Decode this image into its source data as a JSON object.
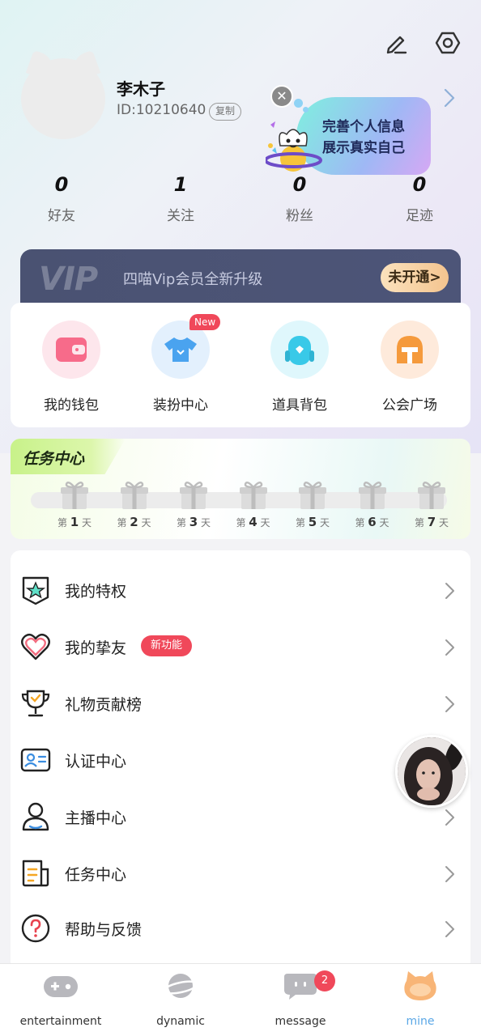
{
  "profile": {
    "username": "李木子",
    "id_text": "ID:10210640",
    "copy_label": "复制"
  },
  "promo_bubble": {
    "line1": "完善个人信息",
    "line2": "展示真实自己"
  },
  "stats": [
    {
      "value": "0",
      "label": "好友"
    },
    {
      "value": "1",
      "label": "关注"
    },
    {
      "value": "0",
      "label": "粉丝"
    },
    {
      "value": "0",
      "label": "足迹"
    }
  ],
  "vip": {
    "logo": "VIP",
    "text": "四喵Vip会员全新升级",
    "button": "未开通>"
  },
  "quick": [
    {
      "label": "我的钱包",
      "icon": "wallet-icon",
      "color": "#f76b8a"
    },
    {
      "label": "装扮中心",
      "icon": "tshirt-icon",
      "color": "#4aa3ef",
      "badge": "New"
    },
    {
      "label": "道具背包",
      "icon": "backpack-icon",
      "color": "#39c9e8"
    },
    {
      "label": "公会广场",
      "icon": "helmet-icon",
      "color": "#f59a3c"
    }
  ],
  "tasks": {
    "title": "任务中心",
    "days": [
      {
        "pre": "第",
        "num": "1",
        "post": "天"
      },
      {
        "pre": "第",
        "num": "2",
        "post": "天"
      },
      {
        "pre": "第",
        "num": "3",
        "post": "天"
      },
      {
        "pre": "第",
        "num": "4",
        "post": "天"
      },
      {
        "pre": "第",
        "num": "5",
        "post": "天"
      },
      {
        "pre": "第",
        "num": "6",
        "post": "天"
      },
      {
        "pre": "第",
        "num": "7",
        "post": "天"
      }
    ]
  },
  "menu": [
    {
      "label": "我的特权",
      "icon": "privilege-icon"
    },
    {
      "label": "我的挚友",
      "icon": "heart-icon",
      "badge": "新功能"
    },
    {
      "label": "礼物贡献榜",
      "icon": "trophy-icon"
    },
    {
      "label": "认证中心",
      "icon": "id-card-icon"
    },
    {
      "label": "主播中心",
      "icon": "person-icon"
    },
    {
      "label": "任务中心",
      "icon": "task-list-icon"
    },
    {
      "label": "帮助与反馈",
      "icon": "help-icon"
    }
  ],
  "nav": [
    {
      "label": "entertainment",
      "icon": "gamepad-icon"
    },
    {
      "label": "dynamic",
      "icon": "planet-icon"
    },
    {
      "label": "message",
      "icon": "chat-bubble-icon",
      "badge": "2"
    },
    {
      "label": "mine",
      "icon": "cat-face-icon",
      "active": true
    }
  ],
  "colors": {
    "accent": "#5aa7e6",
    "badge_red": "#f0485a",
    "vip_bg": "#4a5272"
  }
}
